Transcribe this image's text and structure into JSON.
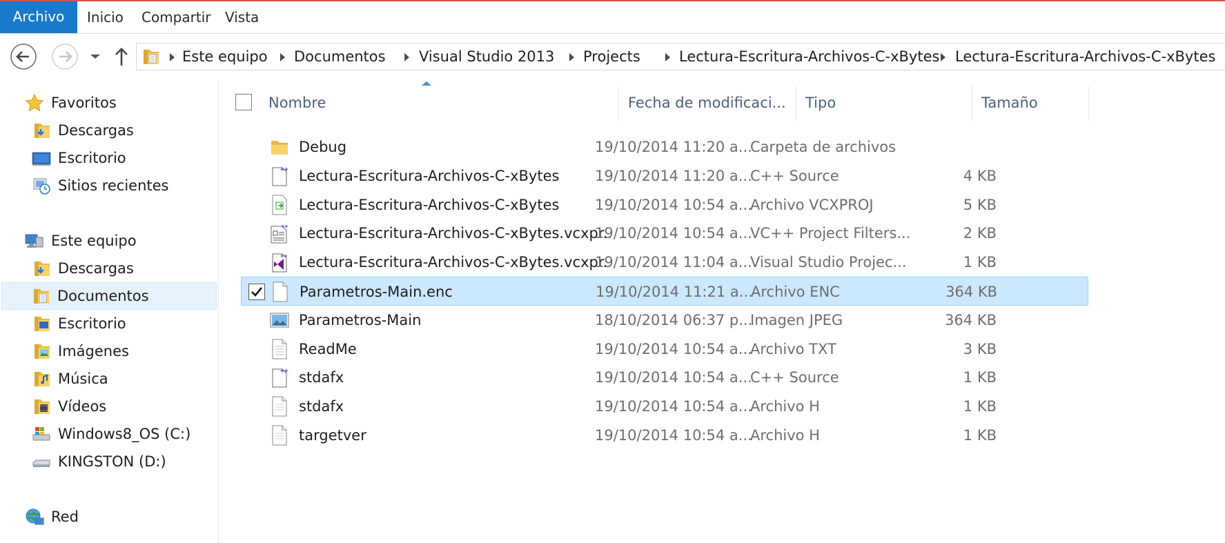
{
  "ribbon": {
    "tabs": [
      "Archivo",
      "Inicio",
      "Compartir",
      "Vista"
    ]
  },
  "address": {
    "crumbs": [
      "Este equipo",
      "Documentos",
      "Visual Studio 2013",
      "Projects",
      "Lectura-Escritura-Archivos-C-xBytes",
      "Lectura-Escritura-Archivos-C-xBytes"
    ]
  },
  "sidebar": {
    "favorites_label": "Favoritos",
    "favorites": [
      "Descargas",
      "Escritorio",
      "Sitios recientes"
    ],
    "this_pc_label": "Este equipo",
    "this_pc": [
      "Descargas",
      "Documentos",
      "Escritorio",
      "Imágenes",
      "Música",
      "Vídeos",
      "Windows8_OS (C:)",
      "KINGSTON (D:)"
    ],
    "network_label": "Red",
    "selected": "Documentos"
  },
  "columns": {
    "name": "Nombre",
    "date": "Fecha de modificaci...",
    "type": "Tipo",
    "size": "Tamaño"
  },
  "files": [
    {
      "name": "Debug",
      "date": "19/10/2014 11:20 a....",
      "type": "Carpeta de archivos",
      "size": "",
      "icon": "folder-icon"
    },
    {
      "name": "Lectura-Escritura-Archivos-C-xBytes",
      "date": "19/10/2014 11:20 a....",
      "type": "C++ Source",
      "size": "4 KB",
      "icon": "cpp-file-icon"
    },
    {
      "name": "Lectura-Escritura-Archivos-C-xBytes",
      "date": "19/10/2014 10:54 a....",
      "type": "Archivo VCXPROJ",
      "size": "5 KB",
      "icon": "vcxproj-file-icon"
    },
    {
      "name": "Lectura-Escritura-Archivos-C-xBytes.vcxpr...",
      "date": "19/10/2014 10:54 a....",
      "type": "VC++ Project Filters...",
      "size": "2 KB",
      "icon": "filters-file-icon"
    },
    {
      "name": "Lectura-Escritura-Archivos-C-xBytes.vcxpr...",
      "date": "19/10/2014 11:04 a....",
      "type": "Visual Studio Projec...",
      "size": "1 KB",
      "icon": "visual-studio-icon"
    },
    {
      "name": "Parametros-Main.enc",
      "date": "19/10/2014 11:21 a....",
      "type": "Archivo ENC",
      "size": "364 KB",
      "icon": "blank-file-icon",
      "selected": true
    },
    {
      "name": "Parametros-Main",
      "date": "18/10/2014 06:37 p....",
      "type": "Imagen JPEG",
      "size": "364 KB",
      "icon": "image-file-icon"
    },
    {
      "name": "ReadMe",
      "date": "19/10/2014 10:54 a....",
      "type": "Archivo TXT",
      "size": "3 KB",
      "icon": "text-file-icon"
    },
    {
      "name": "stdafx",
      "date": "19/10/2014 10:54 a....",
      "type": "C++ Source",
      "size": "1 KB",
      "icon": "cpp-file-icon"
    },
    {
      "name": "stdafx",
      "date": "19/10/2014 10:54 a....",
      "type": "Archivo H",
      "size": "1 KB",
      "icon": "header-file-icon"
    },
    {
      "name": "targetver",
      "date": "19/10/2014 10:54 a....",
      "type": "Archivo H",
      "size": "1 KB",
      "icon": "header-file-icon"
    }
  ],
  "colors": {
    "accent": "#1979ca",
    "selection": "#cce8ff",
    "selection_border": "#99d1ff",
    "header_text": "#4c607a"
  }
}
